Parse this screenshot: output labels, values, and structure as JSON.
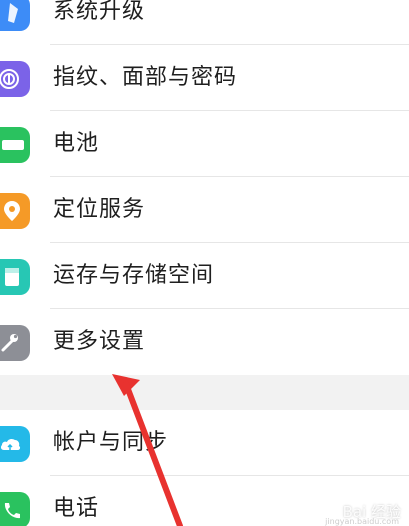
{
  "settings_list": {
    "items": [
      {
        "label": "系统升级",
        "icon": "system-update-icon",
        "color": "#3d8cf7"
      },
      {
        "label": "指纹、面部与密码",
        "icon": "fingerprint-icon",
        "color": "#7b63e8"
      },
      {
        "label": "电池",
        "icon": "battery-icon",
        "color": "#2ac25f"
      },
      {
        "label": "定位服务",
        "icon": "location-icon",
        "color": "#f59a27"
      },
      {
        "label": "运存与存储空间",
        "icon": "storage-icon",
        "color": "#27c7b4"
      },
      {
        "label": "更多设置",
        "icon": "wrench-icon",
        "color": "#8d8f96"
      }
    ],
    "items_group2": [
      {
        "label": "帐户与同步",
        "icon": "cloud-icon",
        "color": "#24b9e8"
      },
      {
        "label": "电话",
        "icon": "phone-icon",
        "color": "#2ac25f"
      }
    ]
  },
  "watermark": {
    "text": "Bai 经验",
    "sub": "jingyan.baidu.com"
  },
  "annotation": {
    "arrow_color": "#e8322f"
  }
}
